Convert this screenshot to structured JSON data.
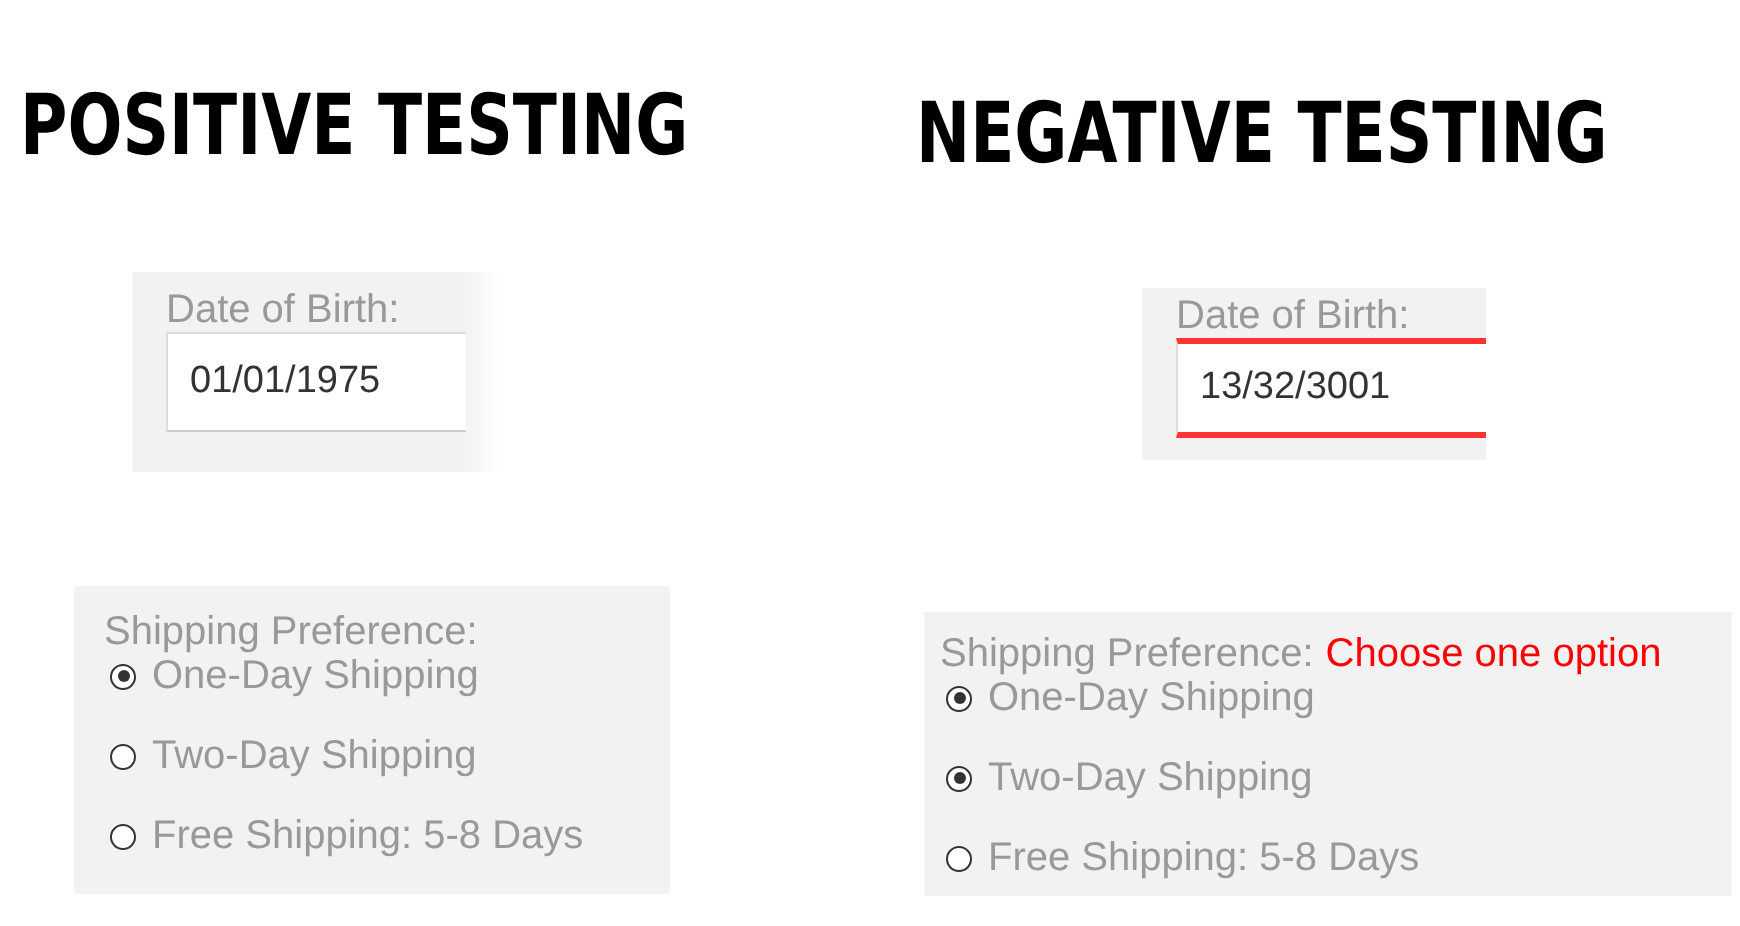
{
  "panels": [
    {
      "heading": "POSITIVE TESTING",
      "date": {
        "label": "Date of Birth:",
        "value": "01/01/1975",
        "invalid": false
      },
      "shipping": {
        "label": "Shipping Preference:",
        "options": [
          {
            "label": "One-Day Shipping",
            "selected": true
          },
          {
            "label": "Two-Day Shipping",
            "selected": false
          },
          {
            "label": "Free Shipping: 5-8 Days",
            "selected": false
          }
        ]
      }
    },
    {
      "heading": "NEGATIVE TESTING",
      "date": {
        "label": "Date of Birth:",
        "value": "13/32/3001",
        "invalid": true
      },
      "shipping": {
        "label": "Shipping Preference:",
        "error": "Choose one option",
        "options": [
          {
            "label": "One-Day Shipping",
            "selected": true
          },
          {
            "label": "Two-Day Shipping",
            "selected": true
          },
          {
            "label": "Free Shipping: 5-8 Days",
            "selected": false
          }
        ]
      }
    }
  ]
}
